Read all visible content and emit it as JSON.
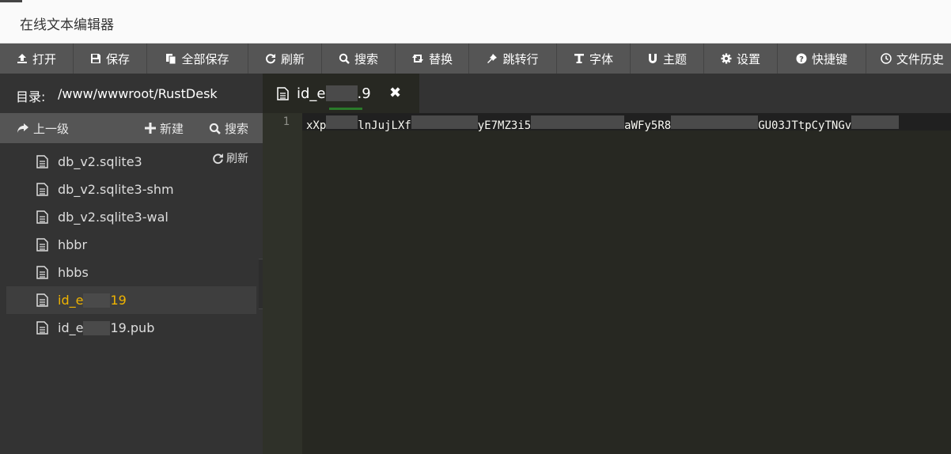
{
  "window": {
    "title": "在线文本编辑器"
  },
  "toolbar": {
    "buttons": [
      {
        "label": "打开",
        "icon": "upload-icon"
      },
      {
        "label": "保存",
        "icon": "save-icon"
      },
      {
        "label": "全部保存",
        "icon": "copy-icon"
      },
      {
        "label": "刷新",
        "icon": "refresh-icon"
      },
      {
        "label": "搜索",
        "icon": "search-icon"
      },
      {
        "label": "替换",
        "icon": "retweet-icon"
      },
      {
        "label": "跳转行",
        "icon": "pushpin-icon"
      },
      {
        "label": "字体",
        "icon": "text-height-icon"
      },
      {
        "label": "主题",
        "icon": "magnet-icon"
      },
      {
        "label": "设置",
        "icon": "gear-icon"
      },
      {
        "label": "快捷键",
        "icon": "question-icon"
      },
      {
        "label": "文件历史",
        "icon": "clock-icon"
      }
    ]
  },
  "sidebar": {
    "dir_label": "目录:",
    "dir_path": "/www/wwwroot/RustDesk",
    "up_label": "上一级",
    "new_label": "新建",
    "search_label": "搜索",
    "refresh_label": "刷新",
    "files": [
      {
        "name": "db_v2.sqlite3",
        "active": false
      },
      {
        "name": "db_v2.sqlite3-shm",
        "active": false
      },
      {
        "name": "db_v2.sqlite3-wal",
        "active": false
      },
      {
        "name": "hbbr",
        "active": false
      },
      {
        "name": "hbbs",
        "active": false
      },
      {
        "name": "id_e",
        "suffix": "19",
        "active": true
      },
      {
        "name": "id_e",
        "suffix": "19.pub",
        "active": false
      }
    ]
  },
  "tab": {
    "label_prefix": "id_e",
    "label_suffix": ".9",
    "close": "✖"
  },
  "editor": {
    "line_number": "1",
    "segments": [
      "xXp",
      "lnJujLXf",
      "yE7MZ3i5",
      "aWFy5R8",
      "GU03JTtpCyTNGv"
    ]
  },
  "colors": {
    "toolbar": "#555555",
    "sidebar": "#333333",
    "editor": "#272822",
    "active_file": "#f0b400"
  }
}
